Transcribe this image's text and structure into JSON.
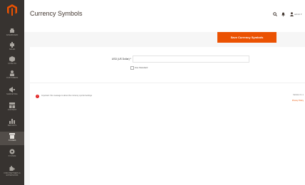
{
  "colors": {
    "sidebar_bg": "#373330",
    "accent": "#eb5202",
    "error": "#e22626"
  },
  "page": {
    "title": "Currency Symbols"
  },
  "header": {
    "search_icon": "search-icon",
    "bell_icon": "bell-icon",
    "user_icon": "user-icon",
    "user_name": "admin ▾"
  },
  "actions": {
    "save_label": "Save Currency Symbols"
  },
  "form": {
    "field_label": "USD (US Dollar) *",
    "field_value": "",
    "checkbox_label": "Use Standard"
  },
  "message": {
    "text": "Important: this message is about the currency symbol settings",
    "icon": "!"
  },
  "side": {
    "note": "Version 2.x.x",
    "link": "Privacy Policy"
  },
  "sidebar": {
    "items": [
      {
        "label": "DASHBOARD",
        "icon": "dashboard-icon"
      },
      {
        "label": "SALES",
        "icon": "dollar-icon"
      },
      {
        "label": "CATALOG",
        "icon": "box-icon"
      },
      {
        "label": "CUSTOMERS",
        "icon": "person-icon"
      },
      {
        "label": "MARKETING",
        "icon": "megaphone-icon"
      },
      {
        "label": "CONTENT",
        "icon": "layout-icon"
      },
      {
        "label": "REPORTS",
        "icon": "bar-chart-icon"
      },
      {
        "label": "STORES",
        "icon": "store-icon"
      },
      {
        "label": "SYSTEM",
        "icon": "gear-icon"
      },
      {
        "label": "FIND PARTNERS & EXTENSIONS",
        "icon": "puzzle-icon"
      }
    ]
  }
}
